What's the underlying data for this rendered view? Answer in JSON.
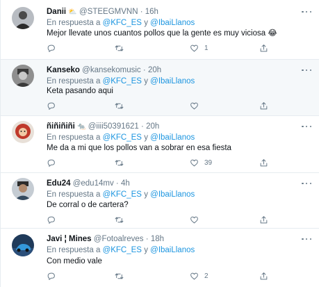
{
  "tweets": [
    {
      "name": "Danii",
      "name_emoji": "⛅",
      "handle": "@STEEGMVNN",
      "time": "16h",
      "reply_prefix": "En respuesta a",
      "mention1": "@KFC_ES",
      "reply_and": "y",
      "mention2": "@IbaiLlanos",
      "text": "Mejor llevate unos cuantos pollos que la gente es muy viciosa 😂",
      "likes": "1",
      "avatar_color": "#9aa0a6"
    },
    {
      "name": "Kanseko",
      "name_emoji": "",
      "handle": "@kansekomusic",
      "time": "20h",
      "reply_prefix": "En respuesta a",
      "mention1": "@KFC_ES",
      "reply_and": "y",
      "mention2": "@IbaiLlanos",
      "text": "Keta pasando aqui",
      "likes": "",
      "avatar_color": "#6e6e6e"
    },
    {
      "name": "ñiñiñiñi",
      "name_emoji": "🐀",
      "handle": "@iiii50391621",
      "time": "20h",
      "reply_prefix": "En respuesta a",
      "mention1": "@KFC_ES",
      "reply_and": "y",
      "mention2": "@IbaiLlanos",
      "text": "Me da a mi que los pollos van a sobrar en esa fiesta",
      "likes": "39",
      "avatar_color": "#c0392b"
    },
    {
      "name": "Edu24",
      "name_emoji": "",
      "handle": "@edu14mv",
      "time": "4h",
      "reply_prefix": "En respuesta a",
      "mention1": "@KFC_ES",
      "reply_and": "y",
      "mention2": "@IbaiLlanos",
      "text": "De corral o de cartera?",
      "likes": "",
      "avatar_color": "#5d6d7e"
    },
    {
      "name": "Javi ¦ Mines",
      "name_emoji": "",
      "handle": "@Fotoalreves",
      "time": "18h",
      "reply_prefix": "En respuesta a",
      "mention1": "@KFC_ES",
      "reply_and": "y",
      "mention2": "@IbaiLlanos",
      "text": "Con medio vale",
      "likes": "2",
      "avatar_color": "#2e86c1"
    }
  ],
  "sep": "·"
}
